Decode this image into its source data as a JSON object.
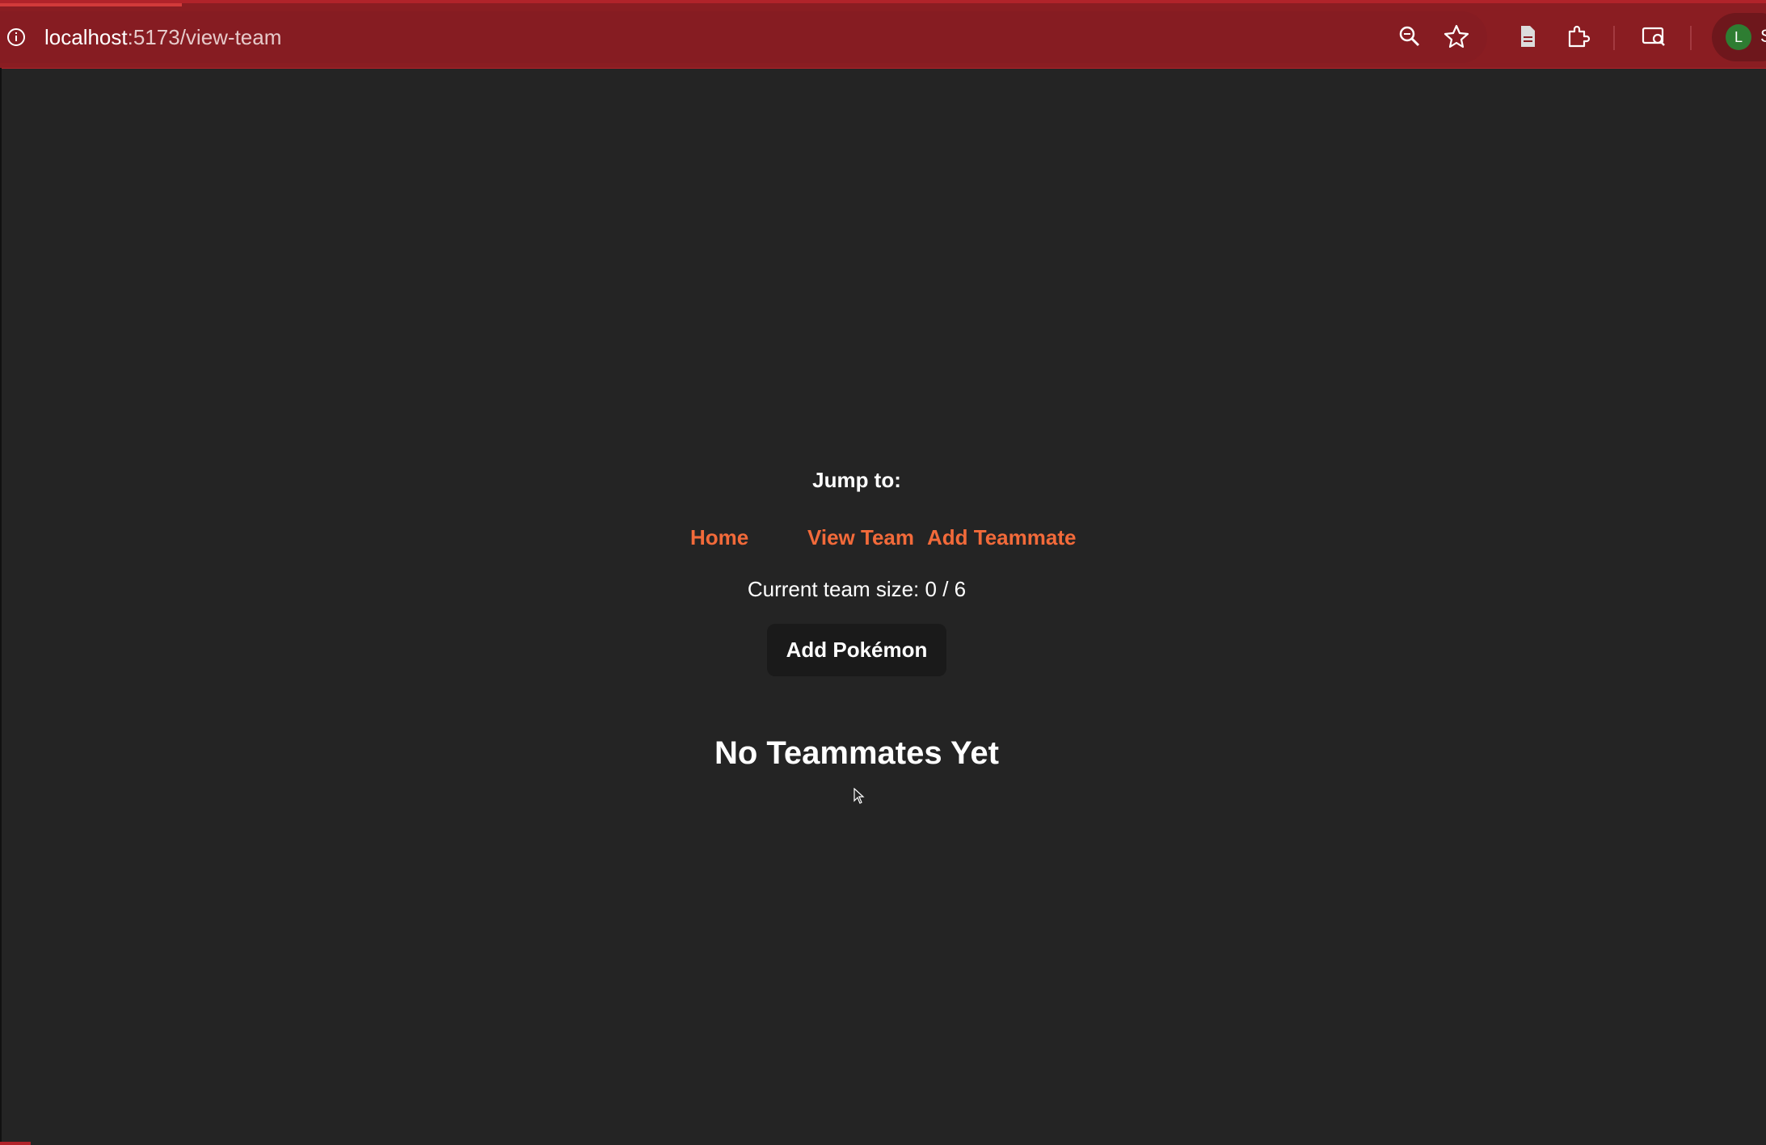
{
  "browser": {
    "url_host": "localhost",
    "url_rest": ":5173/view-team",
    "profile_initial": "L",
    "profile_name_partial": "S",
    "accent_color": "#8a1d22",
    "icons": [
      "info-icon",
      "zoom-icon",
      "star-icon",
      "document-icon",
      "extensions-icon",
      "lens-search-icon",
      "avatar"
    ]
  },
  "page": {
    "jump_label": "Jump to:",
    "nav_links": [
      "Home",
      "View Team",
      "Add Teammate"
    ],
    "team_size_text": "Current team size: 0 / 6",
    "add_button_label": "Add Pokémon",
    "empty_heading": "No Teammates Yet",
    "link_color": "#f26a3a",
    "background_color": "#242424"
  }
}
